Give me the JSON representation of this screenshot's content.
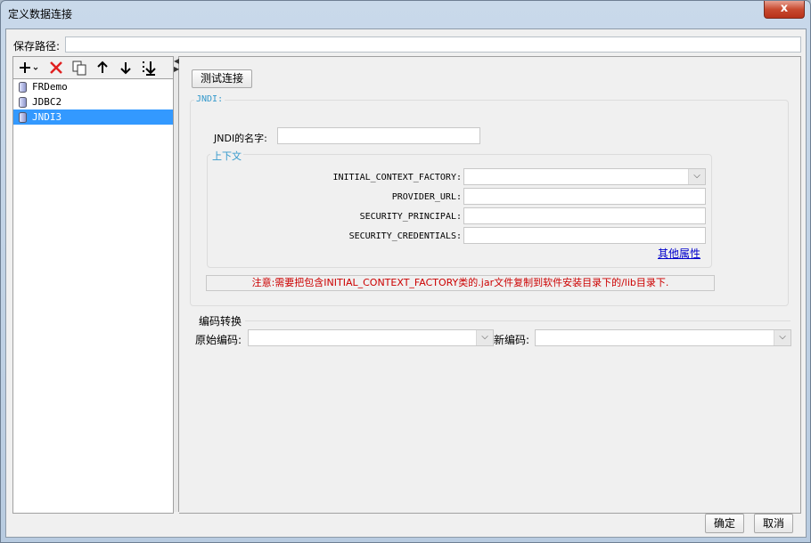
{
  "window": {
    "title": "定义数据连接",
    "close_glyph": "x"
  },
  "path": {
    "label": "保存路径:",
    "value": ""
  },
  "toolbar": {
    "icons": [
      "add-icon",
      "delete-icon",
      "copy-icon",
      "move-up-icon",
      "move-down-icon",
      "move-bottom-icon"
    ]
  },
  "connections": [
    {
      "label": "FRDemo",
      "selected": false
    },
    {
      "label": "JDBC2",
      "selected": false
    },
    {
      "label": "JNDI3",
      "selected": true
    }
  ],
  "test_button": "测试连接",
  "jndi": {
    "group_title": "JNDI:",
    "name_label": "JNDI的名字:",
    "name_value": "",
    "context": {
      "title": "上下文",
      "initial_context_factory_label": "INITIAL_CONTEXT_FACTORY:",
      "initial_context_factory_value": "",
      "provider_url_label": "PROVIDER_URL:",
      "provider_url_value": "",
      "security_principal_label": "SECURITY_PRINCIPAL:",
      "security_principal_value": "",
      "security_credentials_label": "SECURITY_CREDENTIALS:",
      "security_credentials_value": "",
      "other_properties_link": "其他属性"
    },
    "note": "注意:需要把包含INITIAL_CONTEXT_FACTORY类的.jar文件复制到软件安装目录下的/lib目录下."
  },
  "encoding": {
    "title": "编码转换",
    "original_label": "原始编码:",
    "original_value": "",
    "new_label": "新编码:",
    "new_value": ""
  },
  "footer": {
    "ok": "确定",
    "cancel": "取消"
  },
  "colors": {
    "accent_blue": "#3399ff",
    "group_title_blue": "#3399cc",
    "note_red": "#cc0000",
    "delete_red": "#e02020"
  }
}
